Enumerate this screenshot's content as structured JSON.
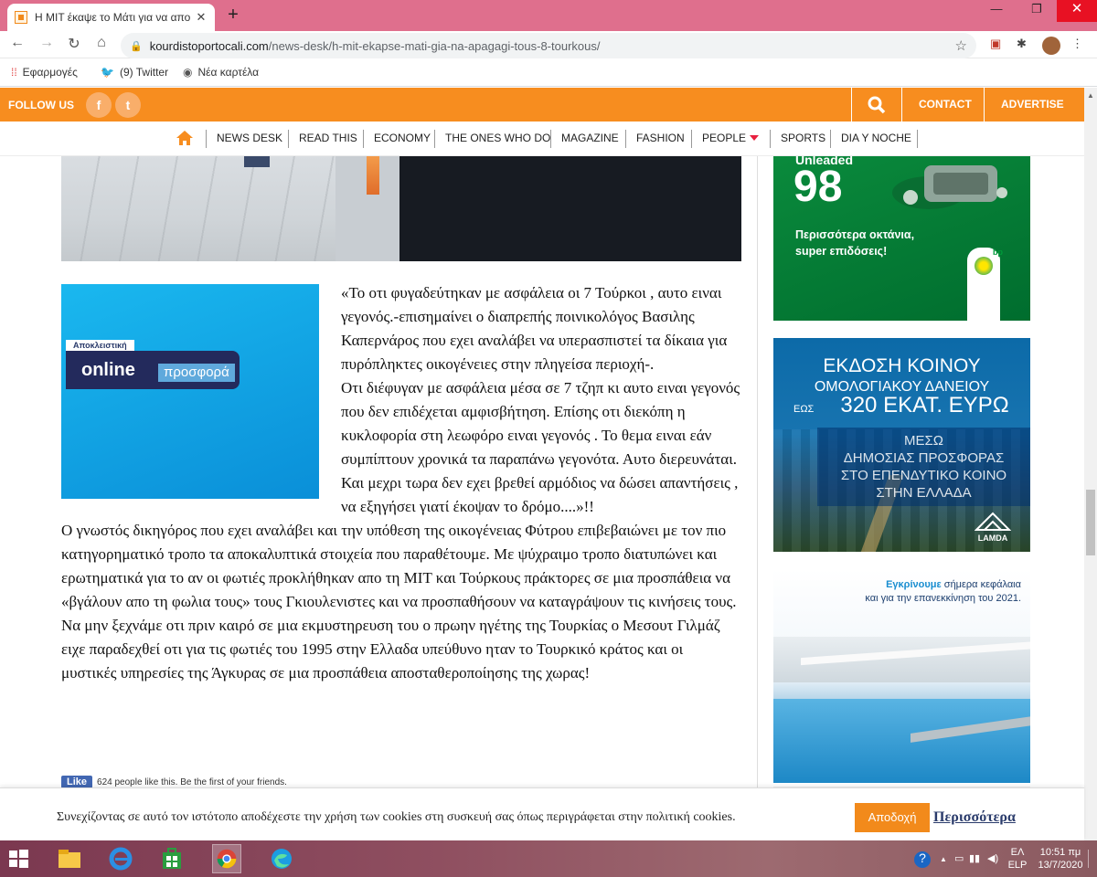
{
  "browser": {
    "tab_title": "Η ΜΙΤ έκαψε το Μάτι για να απο",
    "tab_close": "✕",
    "new_tab": "+",
    "window_controls": [
      "—",
      "❐",
      "✕"
    ],
    "url_host": "kourdistoportocali.com",
    "url_path": "/news-desk/h-mit-ekapse-mati-gia-na-apagagi-tous-8-tourkous/",
    "bookmarks": [
      {
        "label": "Εφαρμογές",
        "icon": "apps-grid-icon"
      },
      {
        "label": "(9) Twitter",
        "icon": "twitter-icon"
      },
      {
        "label": "Νέα καρτέλα",
        "icon": "globe-icon"
      }
    ]
  },
  "site": {
    "follow_us": "FOLLOW US",
    "social": [
      "f",
      "t"
    ],
    "contact": "CONTACT",
    "advertise": "ADVERTISE",
    "nav": [
      "NEWS DESK",
      "READ THIS",
      "ECONOMY",
      "THE ONES WHO DO",
      "MAGAZINE",
      "FASHION",
      "PEOPLE",
      "SPORTS",
      "DIA Y NOCHE"
    ]
  },
  "promo": {
    "label": "Αποκλειστική",
    "online": "online",
    "offer": "προσφορά"
  },
  "article": {
    "paragraphs": [
      "«Το οτι φυγαδεύτηκαν με ασφάλεια οι 7 Τούρκοι , αυτο ειναι γεγονός.-επισημαίνει ο διαπρεπής ποινικολόγος Βασιλης Καπερνάρος που εχει αναλάβει να υπερασπιστεί τα δίκαια για πυρόπληκτες οικογένειες στην πληγείσα περιοχή-.",
      "Οτι διέφυγαν με ασφάλεια μέσα σε 7 τζηπ κι αυτο ειναι γεγονός που δεν επιδέχεται αμφισβήτηση. Επίσης οτι διεκόπη η κυκλοφορία στη λεωφόρο ειναι γεγονός . Το θεμα ειναι εάν συμπίπτουν χρονικά τα παραπάνω γεγονότα. Αυτο διερευνάται. Και μεχρι τωρα δεν εχει βρεθεί αρμόδιος να δώσει απαντήσεις , να εξηγήσει γιατί έκοψαν το δρόμο....»!!",
      "Ο γνωστός δικηγόρος που εχει αναλάβει και την υπόθεση της οικογένειας Φύτρου επιβεβαιώνει με τον πιο κατηγορηματικό τροπο τα αποκαλυπτικά στοιχεία που παραθέτουμε. Με ψύχραιμο τροπο διατυπώνει και ερωτηματικά για το αν οι φωτιές προκλήθηκαν απο τη ΜΙΤ και Τούρκους πράκτορες σε μια προσπάθεια να «βγάλουν απο τη φωλια τους» τους Γκιουλενιστες και να προσπαθήσουν να καταγράψουν τις κινήσεις τους. Να μην ξεχνάμε οτι πριν καιρό σε μια εκμυστηρευση του ο πρωην ηγέτης της Τουρκίας ο Μεσουτ Γιλμάζ ειχε παραδεχθεί οτι για τις φωτιές του 1995 στην Ελλαδα υπεύθυνο ηταν το Τουρκικό κράτος και οι μυστικές υπηρεσίες της Άγκυρας σε μια προσπάθεια αποσταθεροποίησης της χωρας!"
    ],
    "like_button": "Like",
    "like_text": "624 people like this. Be the first of your friends."
  },
  "ads": {
    "fuel": {
      "unleaded": "Unleaded",
      "number": "98",
      "line1": "Περισσότερα οκτάνια,",
      "line2": "super επιδόσεις!",
      "brand": "bp"
    },
    "bond": {
      "line1": "ΕΚΔΟΣΗ ΚΟΙΝΟΥ",
      "line2": "ΟΜΟΛΟΓΙΑΚΟΥ ΔΑΝΕΙΟΥ",
      "upto": "ΕΩΣ",
      "amount": "320 ΕΚΑΤ. ΕΥΡΩ",
      "sub1": "ΜΕΣΩ",
      "sub2": "ΔΗΜΟΣΙΑΣ ΠΡΟΣΦΟΡΑΣ",
      "sub3": "ΣΤΟ ΕΠΕΝΔΥΤΙΚΟ ΚΟΙΝΟ",
      "sub4": "ΣΤΗΝ ΕΛΛΑΔΑ",
      "brand": "LAMDA"
    },
    "loan": {
      "bold": "Εγκρίνουμε",
      "rest": " σήμερα κεφάλαια",
      "line2": "και για την επανεκκίνηση του 2021."
    }
  },
  "cookie": {
    "message": "Συνεχίζοντας σε αυτό τον ιστότοπο αποδέχεστε την χρήση των cookies στη συσκευή σας όπως περιγράφεται στην πολιτική cookies.",
    "accept": "Αποδοχή",
    "more": "Περισσότερα"
  },
  "taskbar": {
    "lang_top": "ΕΛ",
    "lang_bottom": "ELP",
    "time": "10:51 πμ",
    "date": "13/7/2020",
    "tray_arrow": "▲"
  }
}
